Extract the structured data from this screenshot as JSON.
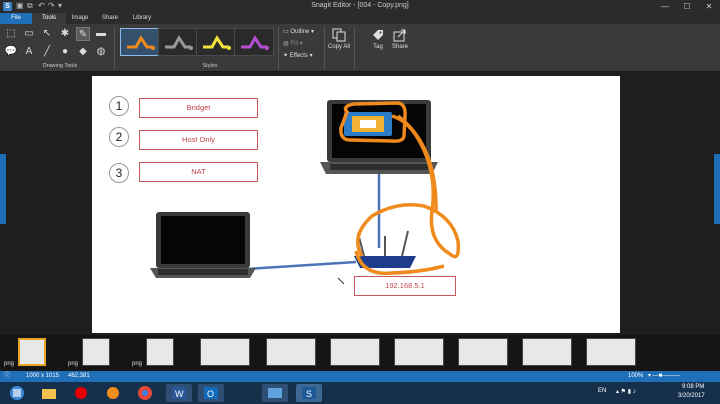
{
  "window": {
    "app_icon_letter": "S",
    "title": "Snagit Editor - [004 - Copy.png]",
    "controls": [
      "—",
      "☐",
      "✕"
    ]
  },
  "tabs": [
    "File",
    "Tools",
    "Image",
    "Share",
    "Library"
  ],
  "ribbon": {
    "drawing_tools_label": "Drawing Tools",
    "styles_label": "Styles",
    "outline_label": "Outline",
    "fill_label": "Fill",
    "effects_label": "Effects",
    "copy_all_label": "Copy All",
    "tag_label": "Tag",
    "share_label": "Share",
    "style_colors": [
      "#f08a1c",
      "#9a9a9a",
      "#f2e23a",
      "#b44fd2"
    ]
  },
  "canvas": {
    "items": [
      {
        "number": "1",
        "label": "Bridget"
      },
      {
        "number": "2",
        "label": "Host Only"
      },
      {
        "number": "3",
        "label": "NAT"
      }
    ],
    "ip_label": "192.168.5.1"
  },
  "tray": {
    "thumb_labels": [
      "png",
      "png",
      "png"
    ]
  },
  "status": {
    "dimensions": "1000 x 1015",
    "coords": "462,381",
    "zoom": "100%"
  },
  "taskbar": {
    "language": "EN",
    "time": "9:08 PM",
    "date": "3/20/2017",
    "icons": [
      "windows-start",
      "file-explorer",
      "vodafone",
      "media-player",
      "chrome",
      "word",
      "outlook",
      "explorer",
      "snagit"
    ]
  }
}
